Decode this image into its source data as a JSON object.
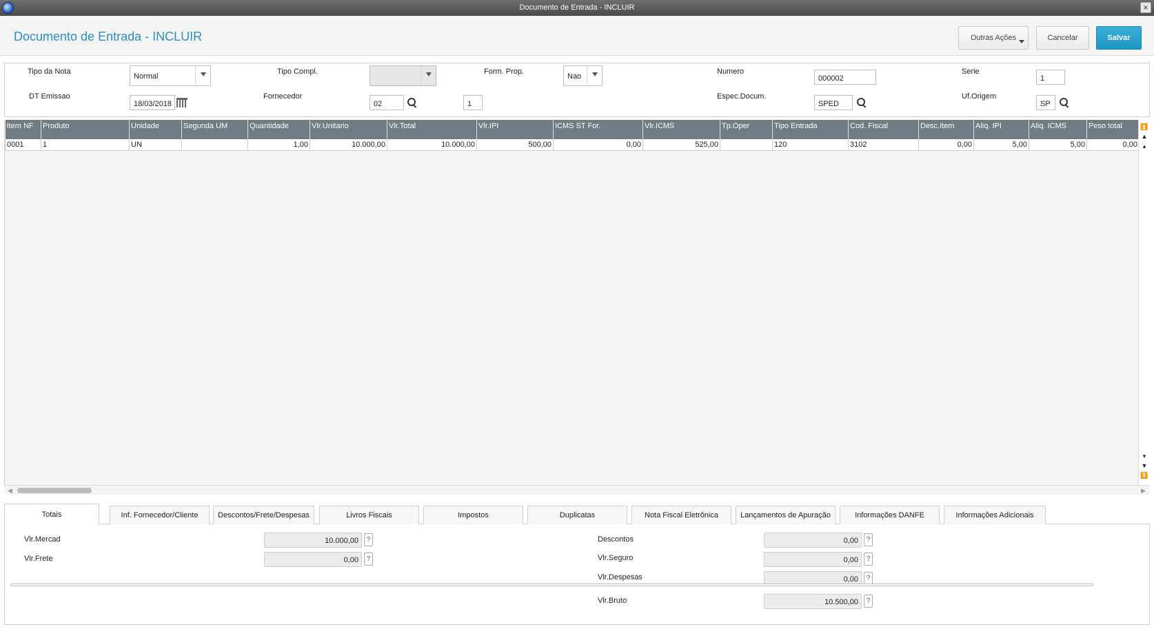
{
  "window": {
    "title": "Documento de Entrada - INCLUIR",
    "close_glyph": "×"
  },
  "header": {
    "title": "Documento de Entrada - INCLUIR",
    "more_label": "Outras Ações",
    "cancel_label": "Cancelar",
    "save_label": "Salvar",
    "save_color": "#1e94c3",
    "title_color": "#2b8fc1"
  },
  "form": {
    "tipo_nota": {
      "label": "Tipo da Nota",
      "value": "Normal"
    },
    "tipo_compl": {
      "label": "Tipo Compl.",
      "value": ""
    },
    "form_prop": {
      "label": "Form. Prop.",
      "value": "Nao"
    },
    "numero": {
      "label": "Numero",
      "value": "000002"
    },
    "serie": {
      "label": "Serie",
      "value": "1"
    },
    "dt_emissao": {
      "label": "DT Emissao",
      "value": "18/03/2018"
    },
    "fornecedor": {
      "label": "Fornecedor",
      "code": "02",
      "loja": "1"
    },
    "espec_docum": {
      "label": "Espec.Docum.",
      "value": "SPED"
    },
    "uf_origem": {
      "label": "Uf.Origem",
      "value": "SP"
    }
  },
  "grid": {
    "columns": [
      "Item NF",
      "Produto",
      "Unidade",
      "Segunda UM",
      "Quantidade",
      "Vlr.Unitario",
      "Vlr.Total",
      "Vlr.IPI",
      "ICMS ST For.",
      "Vlr.ICMS",
      "Tp.Oper",
      "Tipo Entrada",
      "Cod. Fiscal",
      "Desc.Item",
      "Aliq. IPI",
      "Aliq. ICMS",
      "Peso total"
    ],
    "rows": [
      [
        "0001",
        "1",
        "UN",
        "",
        "1,00",
        "10.000,00",
        "10.000,00",
        "500,00",
        "0,00",
        "525,00",
        "",
        "120",
        "3102",
        "0,00",
        "5,00",
        "5,00",
        "0,00"
      ]
    ],
    "header_color": "#6f7c84"
  },
  "tabs": [
    "Totais",
    "Inf. Fornecedor/Cliente",
    "Descontos/Frete/Despesas",
    "Livros Fiscais",
    "Impostos",
    "Duplicatas",
    "Nota Fiscal Eletrônica",
    "Lançamentos de Apuração",
    "Informações DANFE",
    "Informações Adicionais"
  ],
  "active_tab": "Totais",
  "totais": {
    "vlr_mercad": {
      "label": "Vlr.Mercad",
      "value": "10.000,00"
    },
    "vlr_frete": {
      "label": "Vlr.Frete",
      "value": "0,00"
    },
    "descontos": {
      "label": "Descontos",
      "value": "0,00"
    },
    "vlr_seguro": {
      "label": "Vlr.Seguro",
      "value": "0,00"
    },
    "vlr_despesas": {
      "label": "Vlr.Despesas",
      "value": "0,00"
    },
    "vlr_bruto": {
      "label": "Vlr.Bruto",
      "value": "10.500,00"
    },
    "help_glyph": "?"
  }
}
